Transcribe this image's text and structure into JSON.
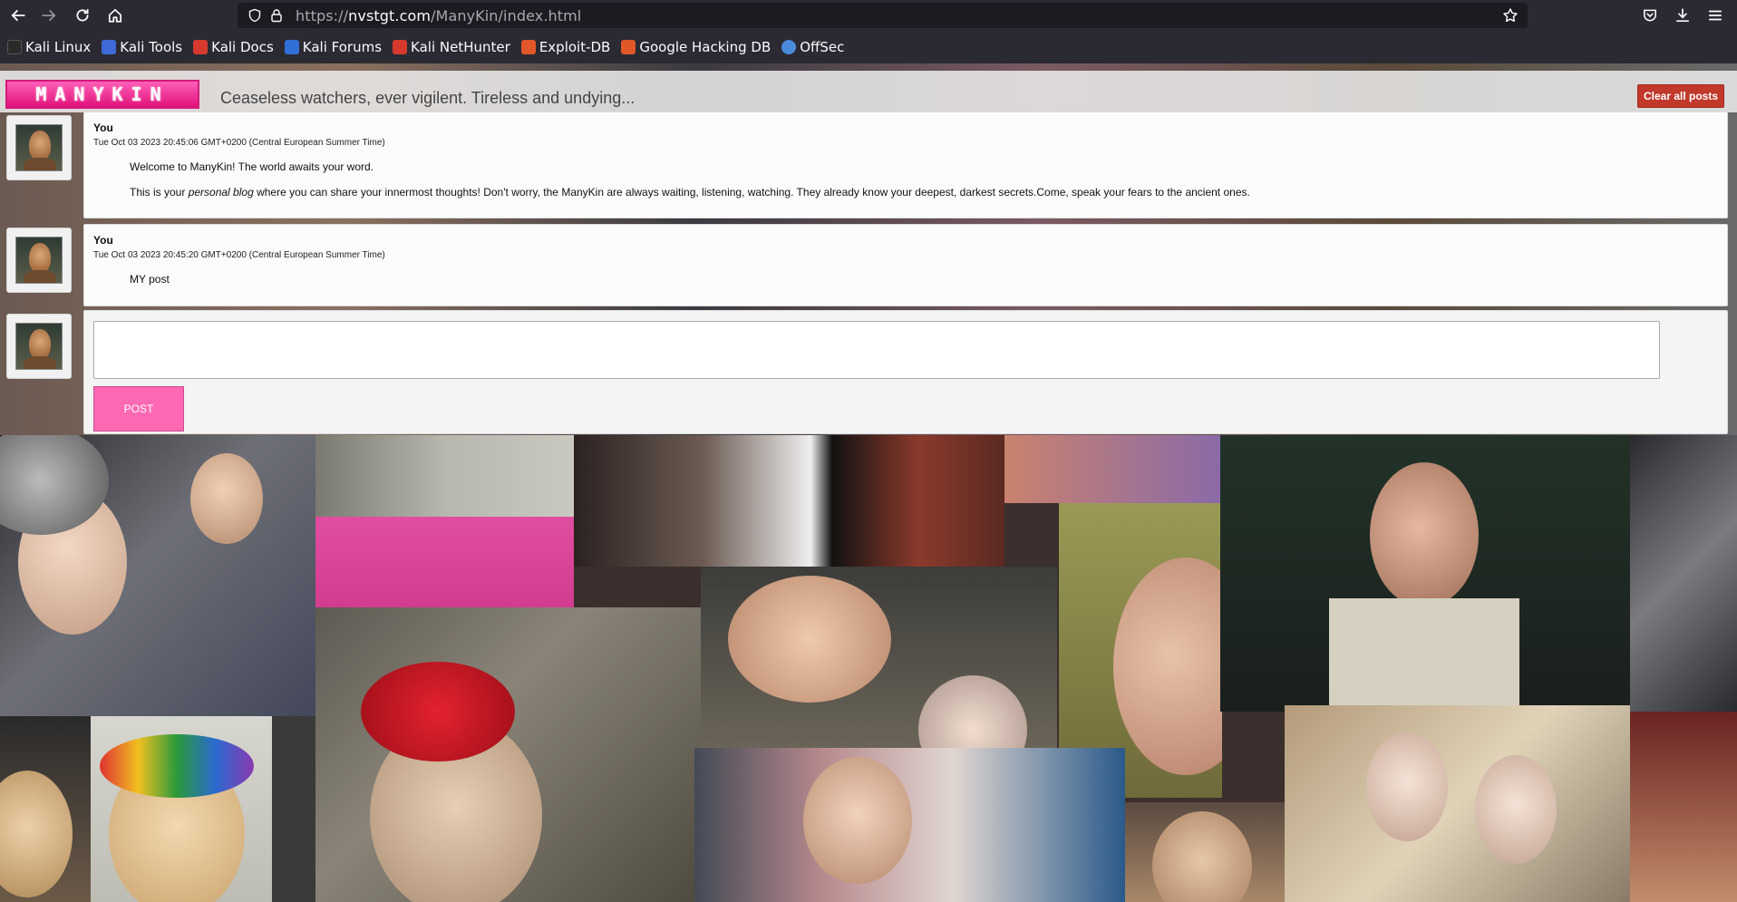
{
  "browser": {
    "url_prefix": "https://",
    "url_host": "nvstgt.com",
    "url_path": "/ManyKin/index.html",
    "bookmarks": [
      {
        "label": "Kali Linux",
        "icon": "kali-dragon-icon",
        "color": "#2a2a2a"
      },
      {
        "label": "Kali Tools",
        "icon": "kali-tools-icon",
        "color": "#3f6ad8"
      },
      {
        "label": "Kali Docs",
        "icon": "kali-docs-icon",
        "color": "#d63a2f"
      },
      {
        "label": "Kali Forums",
        "icon": "kali-forums-icon",
        "color": "#2f6fd6"
      },
      {
        "label": "Kali NetHunter",
        "icon": "nethunter-icon",
        "color": "#d63a2f"
      },
      {
        "label": "Exploit-DB",
        "icon": "exploit-db-icon",
        "color": "#e0572a"
      },
      {
        "label": "Google Hacking DB",
        "icon": "ghdb-icon",
        "color": "#e0572a"
      },
      {
        "label": "OffSec",
        "icon": "offsec-icon",
        "color": "#4a8bdc"
      }
    ]
  },
  "site": {
    "logo_text": "MANYKIN",
    "tagline": "Ceaseless watchers, ever vigilent. Tireless and undying...",
    "clear_button": "Clear all posts",
    "accent": "#ff69b4",
    "danger": "#c0392b"
  },
  "posts": [
    {
      "author": "You",
      "date": "Tue Oct 03 2023 20:45:06 GMT+0200 (Central European Summer Time)",
      "line1": "Welcome to ManyKin! The world awaits your word.",
      "line2_a": "This is your ",
      "line2_em": "personal blog",
      "line2_b": " where you can share your innermost thoughts! Don't worry, the ManyKin are always waiting, listening, watching. They already know your deepest, darkest secrets.Come, speak your fears to the ancient ones."
    },
    {
      "author": "You",
      "date": "Tue Oct 03 2023 20:45:20 GMT+0200 (Central European Summer Time)",
      "line1": "MY post"
    }
  ],
  "compose": {
    "value": "",
    "post_button": "POST"
  }
}
